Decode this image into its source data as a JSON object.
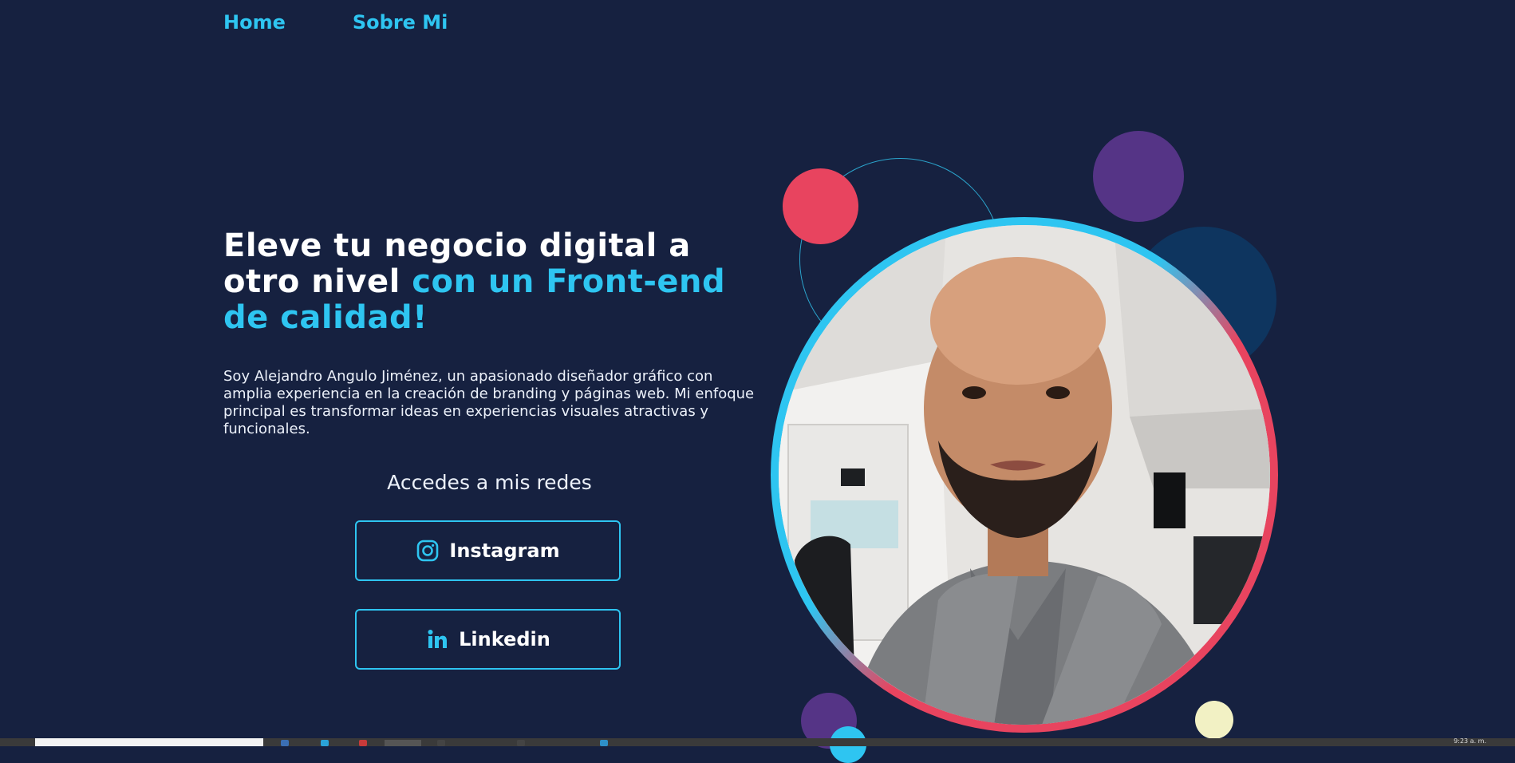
{
  "nav": {
    "home": "Home",
    "about": "Sobre Mi"
  },
  "hero": {
    "title_plain": "Eleve tu negocio digital a otro nivel",
    "title_accent": "con un Front-end de calidad!",
    "intro": "Soy Alejandro Angulo Jiménez, un apasionado diseñador gráfico con amplia experiencia en la creación de branding y páginas web. Mi enfoque principal es transformar ideas en experiencias visuales atractivas y funcionales."
  },
  "networks": {
    "heading": "Accedes a mis redes",
    "instagram_label": "Instagram",
    "linkedin_label": "Linkedin"
  },
  "taskbar": {
    "clock": "9:23 a. m."
  },
  "icons": {
    "instagram": "instagram-icon",
    "linkedin": "linkedin-icon"
  },
  "colors": {
    "background": "#162140",
    "accent": "#2ec5f1",
    "coral": "#e8445f",
    "purple": "#553486",
    "navy_circle": "#0e355f",
    "cream": "#f2f1c4"
  }
}
